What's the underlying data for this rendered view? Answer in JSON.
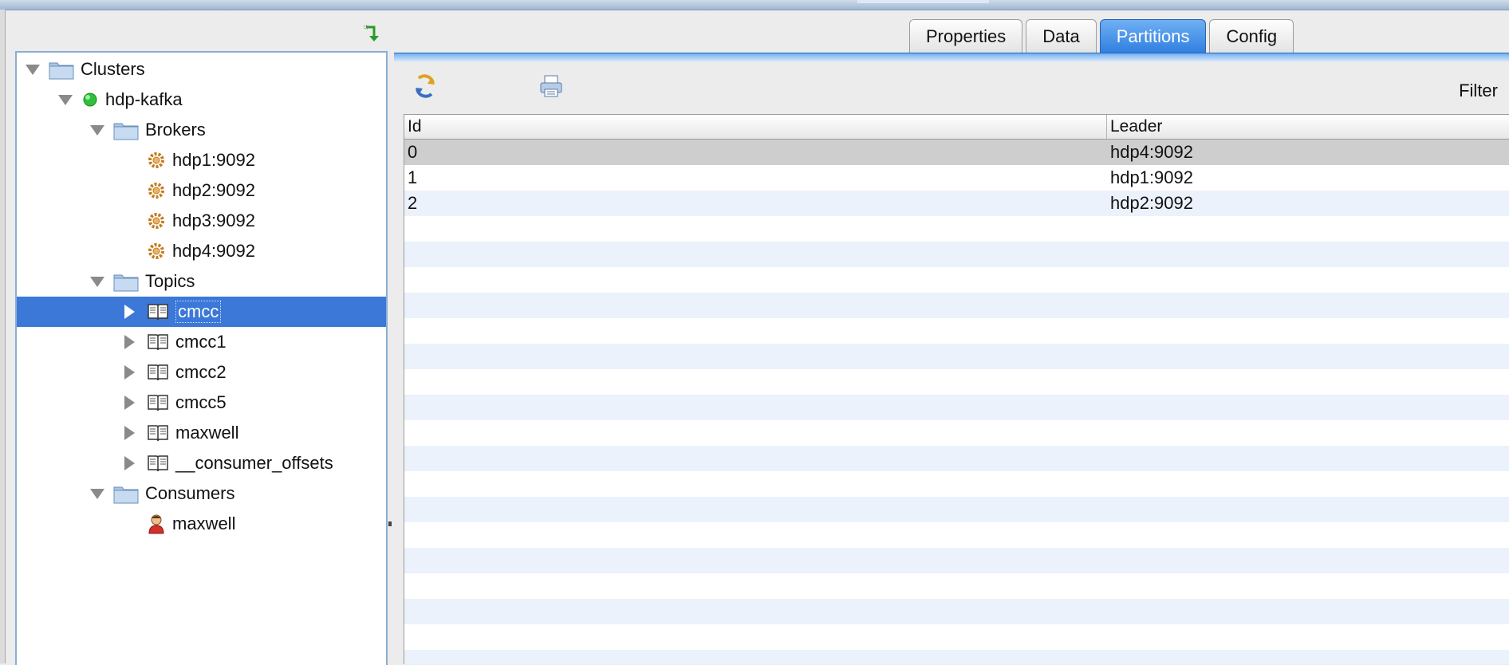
{
  "tree": {
    "root": "Clusters",
    "cluster": "hdp-kafka",
    "brokers_label": "Brokers",
    "brokers": [
      "hdp1:9092",
      "hdp2:9092",
      "hdp3:9092",
      "hdp4:9092"
    ],
    "topics_label": "Topics",
    "topics": [
      "cmcc",
      "cmcc1",
      "cmcc2",
      "cmcc5",
      "maxwell",
      "__consumer_offsets"
    ],
    "selected_topic": "cmcc",
    "consumers_label": "Consumers",
    "consumers": [
      "maxwell"
    ]
  },
  "tabs": [
    {
      "label": "Properties",
      "active": false
    },
    {
      "label": "Data",
      "active": false
    },
    {
      "label": "Partitions",
      "active": true
    },
    {
      "label": "Config",
      "active": false
    }
  ],
  "toolbar": {
    "filter_label": "Filter"
  },
  "table": {
    "columns": [
      "Id",
      "Leader"
    ],
    "rows": [
      {
        "id": "0",
        "leader": "hdp4:9092"
      },
      {
        "id": "1",
        "leader": "hdp1:9092"
      },
      {
        "id": "2",
        "leader": "hdp2:9092"
      }
    ],
    "selected_row": 0
  },
  "colors": {
    "selection": "#3b78d8",
    "tab_active": "#2f7ee0",
    "row_stripe": "#ecf2fb",
    "row_selected": "#cecece",
    "status_online": "#2fbf3a"
  },
  "icons": {
    "folder": "folder-icon",
    "cluster_status": "status-online-icon",
    "broker": "gear-icon",
    "topic": "book-icon",
    "consumer": "user-icon",
    "refresh": "refresh-icon",
    "sync": "sync-arrow-icon",
    "print": "print-icon"
  }
}
